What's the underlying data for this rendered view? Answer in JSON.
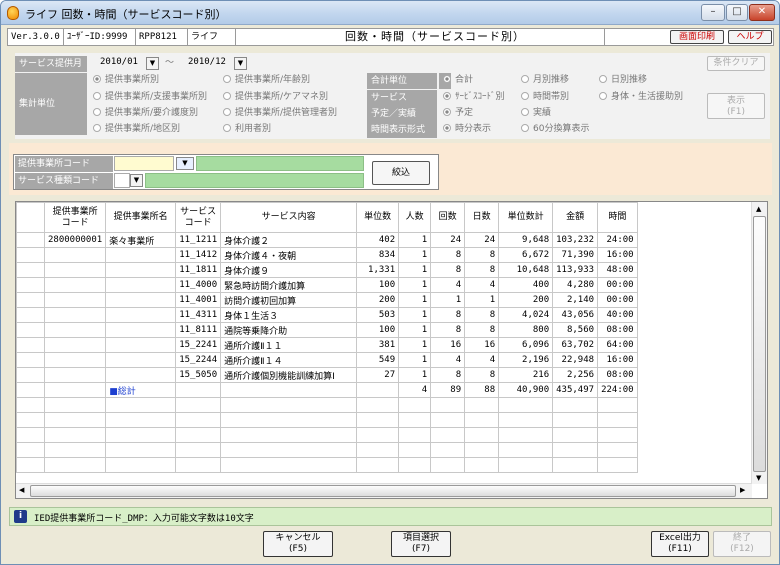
{
  "window": {
    "title": "ライフ 回数・時間（サービスコード別）"
  },
  "header": {
    "version": "Ver.3.0.0",
    "user": "ﾕｰｻﾞｰID:9999",
    "program": "RPP8121",
    "app": "ライフ",
    "screen_title": "回数・時間（サービスコード別）",
    "print_button": "画面印刷",
    "help_button": "ヘルプ"
  },
  "conditions": {
    "period_label": "サービス提供月",
    "period_from": "2010/01",
    "period_sep": "～",
    "period_to": "2010/12",
    "clear_button": "条件クリア",
    "unit_label": "集計単位",
    "unit_options": [
      "提供事業所別",
      "提供事業所/年齢別",
      "提供事業所/支援事業所別",
      "提供事業所/ケアマネ別",
      "提供事業所/要介護度別",
      "提供事業所/提供管理者別",
      "提供事業所/地区別",
      "利用者別"
    ],
    "agg_label": "合計単位",
    "agg_options": [
      "合計",
      "月別推移",
      "日別推移"
    ],
    "service_label": "サービス",
    "service_options": [
      "ｻｰﾋﾞｽｺｰﾄﾞ別",
      "時間帯別",
      "身体・生活援助別"
    ],
    "plan_label": "予定／実績",
    "plan_options": [
      "予定",
      "実績"
    ],
    "time_label": "時間表示形式",
    "time_options": [
      "時分表示",
      "60分換算表示"
    ],
    "show_button": "表示",
    "show_key": "(F1)"
  },
  "filter": {
    "office_label": "提供事業所コード",
    "service_type_label": "サービス種類コード",
    "narrow_button": "絞込"
  },
  "table": {
    "headers": [
      "提供事業所\nコード",
      "提供事業所名",
      "サービス\nコード",
      "サービス内容",
      "単位数",
      "人数",
      "回数",
      "日数",
      "単位数計",
      "金額",
      "時間"
    ],
    "office_code": "2800000001",
    "office_name": "楽々事業所",
    "rows": [
      [
        "11_1211",
        "身体介護２",
        "402",
        "1",
        "24",
        "24",
        "9,648",
        "103,232",
        "24:00"
      ],
      [
        "11_1412",
        "身体介護４・夜朝",
        "834",
        "1",
        "8",
        "8",
        "6,672",
        "71,390",
        "16:00"
      ],
      [
        "11_1811",
        "身体介護９",
        "1,331",
        "1",
        "8",
        "8",
        "10,648",
        "113,933",
        "48:00"
      ],
      [
        "11_4000",
        "緊急時訪問介護加算",
        "100",
        "1",
        "4",
        "4",
        "400",
        "4,280",
        "00:00"
      ],
      [
        "11_4001",
        "訪問介護初回加算",
        "200",
        "1",
        "1",
        "1",
        "200",
        "2,140",
        "00:00"
      ],
      [
        "11_4311",
        "身体１生活３",
        "503",
        "1",
        "8",
        "8",
        "4,024",
        "43,056",
        "40:00"
      ],
      [
        "11_8111",
        "通院等乗降介助",
        "100",
        "1",
        "8",
        "8",
        "800",
        "8,560",
        "08:00"
      ],
      [
        "15_2241",
        "通所介護Ⅱ１１",
        "381",
        "1",
        "16",
        "16",
        "6,096",
        "63,702",
        "64:00"
      ],
      [
        "15_2244",
        "通所介護Ⅱ１４",
        "549",
        "1",
        "4",
        "4",
        "2,196",
        "22,948",
        "16:00"
      ],
      [
        "15_5050",
        "通所介護個別機能訓練加算Ⅰ",
        "27",
        "1",
        "8",
        "8",
        "216",
        "2,256",
        "08:00"
      ]
    ],
    "total_label": "■総計",
    "total": [
      "4",
      "89",
      "88",
      "40,900",
      "435,497",
      "224:00"
    ]
  },
  "status": {
    "icon": "i",
    "message": "IED提供事業所コード_DMP：入力可能文字数は10文字"
  },
  "footer": {
    "cancel": "キャンセル",
    "cancel_key": "(F5)",
    "item_select": "項目選択",
    "item_select_key": "(F7)",
    "excel": "Excel出力",
    "excel_key": "(F11)",
    "exit": "終了",
    "exit_key": "(F12)"
  }
}
